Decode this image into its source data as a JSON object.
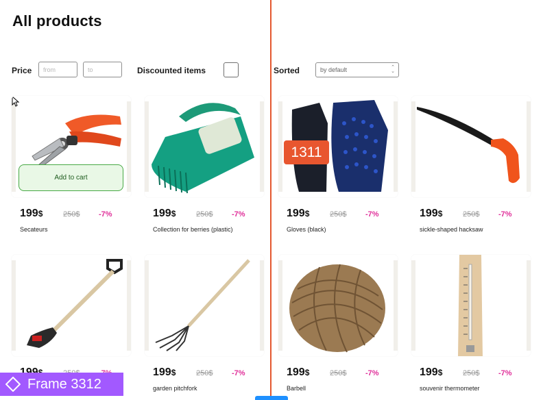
{
  "page": {
    "title": "All products"
  },
  "filters": {
    "price_label": "Price",
    "from_placeholder": "from",
    "to_placeholder": "to",
    "discount_label": "Discounted items",
    "sort_label": "Sorted",
    "sort_value": "by default"
  },
  "product_card": {
    "add_to_cart_label": "Add to cart",
    "currency": "$"
  },
  "products": [
    {
      "name": "Secateurs",
      "price": "199",
      "old_price": "250$",
      "discount": "-7%"
    },
    {
      "name": "Collection for berries (plastic)",
      "price": "199",
      "old_price": "250$",
      "discount": "-7%"
    },
    {
      "name": "Gloves (black)",
      "price": "199",
      "old_price": "250$",
      "discount": "-7%",
      "badge": "1311"
    },
    {
      "name": "sickle-shaped hacksaw",
      "price": "199",
      "old_price": "250$",
      "discount": "-7%"
    },
    {
      "name": "",
      "price": "199",
      "old_price": "250$",
      "discount": "-7%"
    },
    {
      "name": "garden pitchfork",
      "price": "199",
      "old_price": "250$",
      "discount": "-7%"
    },
    {
      "name": "Barbell",
      "price": "199",
      "old_price": "250$",
      "discount": "-7%"
    },
    {
      "name": "souvenir thermometer",
      "price": "199",
      "old_price": "250$",
      "discount": "-7%"
    }
  ],
  "overlay": {
    "frame_label": "Frame 3312"
  },
  "colors": {
    "divider": "#e4572e",
    "discount": "#e0309a",
    "cart_button_border": "#46a843",
    "frame_label_bg": "#a259ff"
  },
  "icons": [
    "cursor-arrow-icon",
    "frame-diamond-icon",
    "chevron-up-down-icon"
  ]
}
